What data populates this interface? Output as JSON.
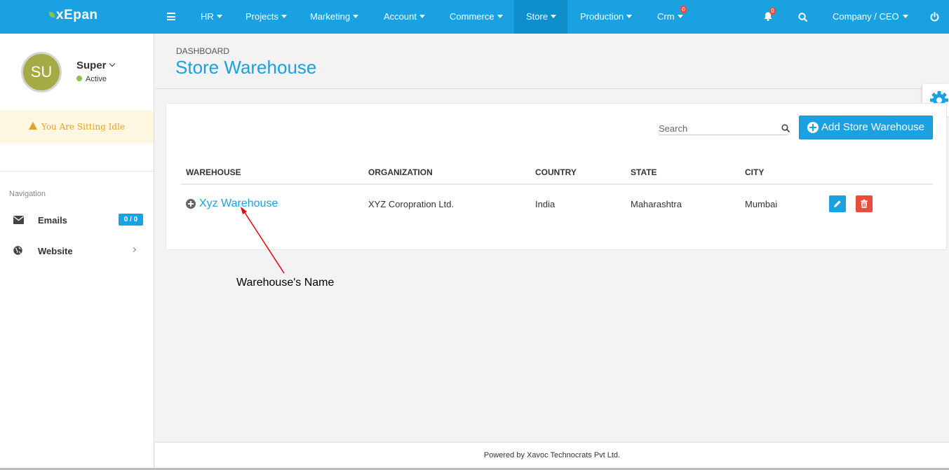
{
  "app": {
    "logo": "xEpan"
  },
  "topnav": {
    "items": [
      {
        "label": "HR"
      },
      {
        "label": "Projects"
      },
      {
        "label": "Marketing"
      },
      {
        "label": "Account"
      },
      {
        "label": "Commerce"
      },
      {
        "label": "Store",
        "active": true
      },
      {
        "label": "Production"
      },
      {
        "label": "Crm",
        "badge": "0"
      }
    ],
    "notification_count": "0",
    "user_menu": "Company / CEO"
  },
  "sidebar": {
    "avatar_initials": "SU",
    "user_name": "Super",
    "user_status": "Active",
    "idle_message": "You Are Sitting Idle",
    "nav_heading": "Navigation",
    "items": [
      {
        "label": "Emails",
        "badge": "0 / 0",
        "icon": "envelope-icon"
      },
      {
        "label": "Website",
        "icon": "globe-icon"
      }
    ]
  },
  "page": {
    "breadcrumb": "DASHBOARD",
    "title": "Store Warehouse"
  },
  "toolbar": {
    "search_placeholder": "Search",
    "add_label": "Add Store Warehouse"
  },
  "table": {
    "headers": [
      "WAREHOUSE",
      "ORGANIZATION",
      "COUNTRY",
      "STATE",
      "CITY"
    ],
    "rows": [
      {
        "warehouse": "Xyz Warehouse",
        "organization": "XYZ Coropration Ltd.",
        "country": "India",
        "state": "Maharashtra",
        "city": "Mumbai"
      }
    ]
  },
  "annotation": {
    "text": "Warehouse's Name"
  },
  "footer": {
    "text": "Powered by Xavoc Technocrats Pvt Ltd."
  },
  "colors": {
    "primary": "#1aa1e1",
    "danger": "#e74c3c",
    "warning": "#e4a12a",
    "avatar": "#a5aa45",
    "status_active": "#8bc34a"
  }
}
